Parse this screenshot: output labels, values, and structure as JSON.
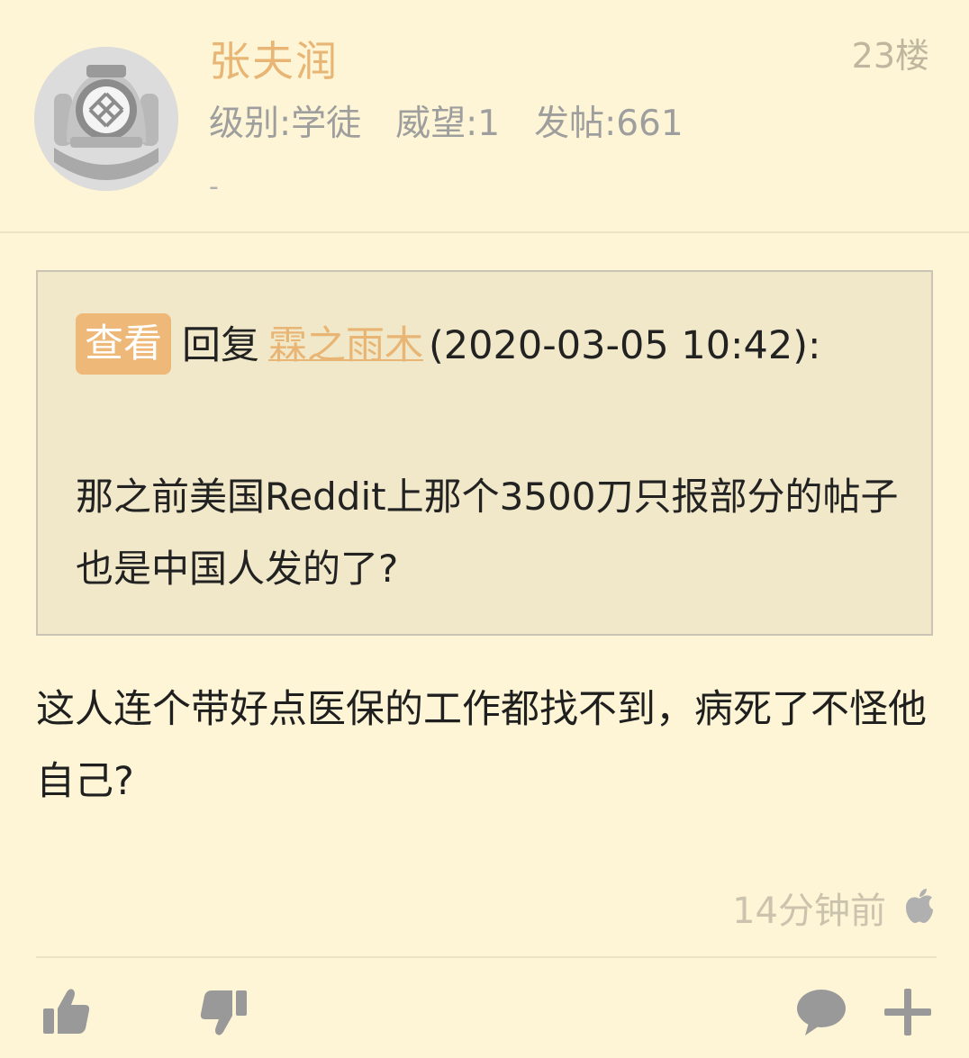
{
  "post": {
    "author": "张夫润",
    "floor": "23楼",
    "level": "级别:学徒",
    "reputation": "威望:1",
    "posts": "发帖:661",
    "signature": "-",
    "quote": {
      "view_label": "查看",
      "reply_word": "回复",
      "user": "霖之雨木",
      "time": "(2020-03-05 10:42):",
      "text": "那之前美国Reddit上那个3500刀只报部分的帖子也是中国人发的了?"
    },
    "body": "这人连个带好点医保的工作都找不到，病死了不怪他自己?",
    "time_ago": "14分钟前"
  },
  "icons": {
    "avatar": "diver-helmet-avatar",
    "device": "apple-icon",
    "like": "thumbs-up-icon",
    "dislike": "thumbs-down-icon",
    "comment": "comment-bubble-icon",
    "more": "plus-icon"
  },
  "colors": {
    "background": "#fdf5d5",
    "accent": "#e8b574",
    "quote_background": "#f0e8c8",
    "icon": "#9a9a9a"
  }
}
